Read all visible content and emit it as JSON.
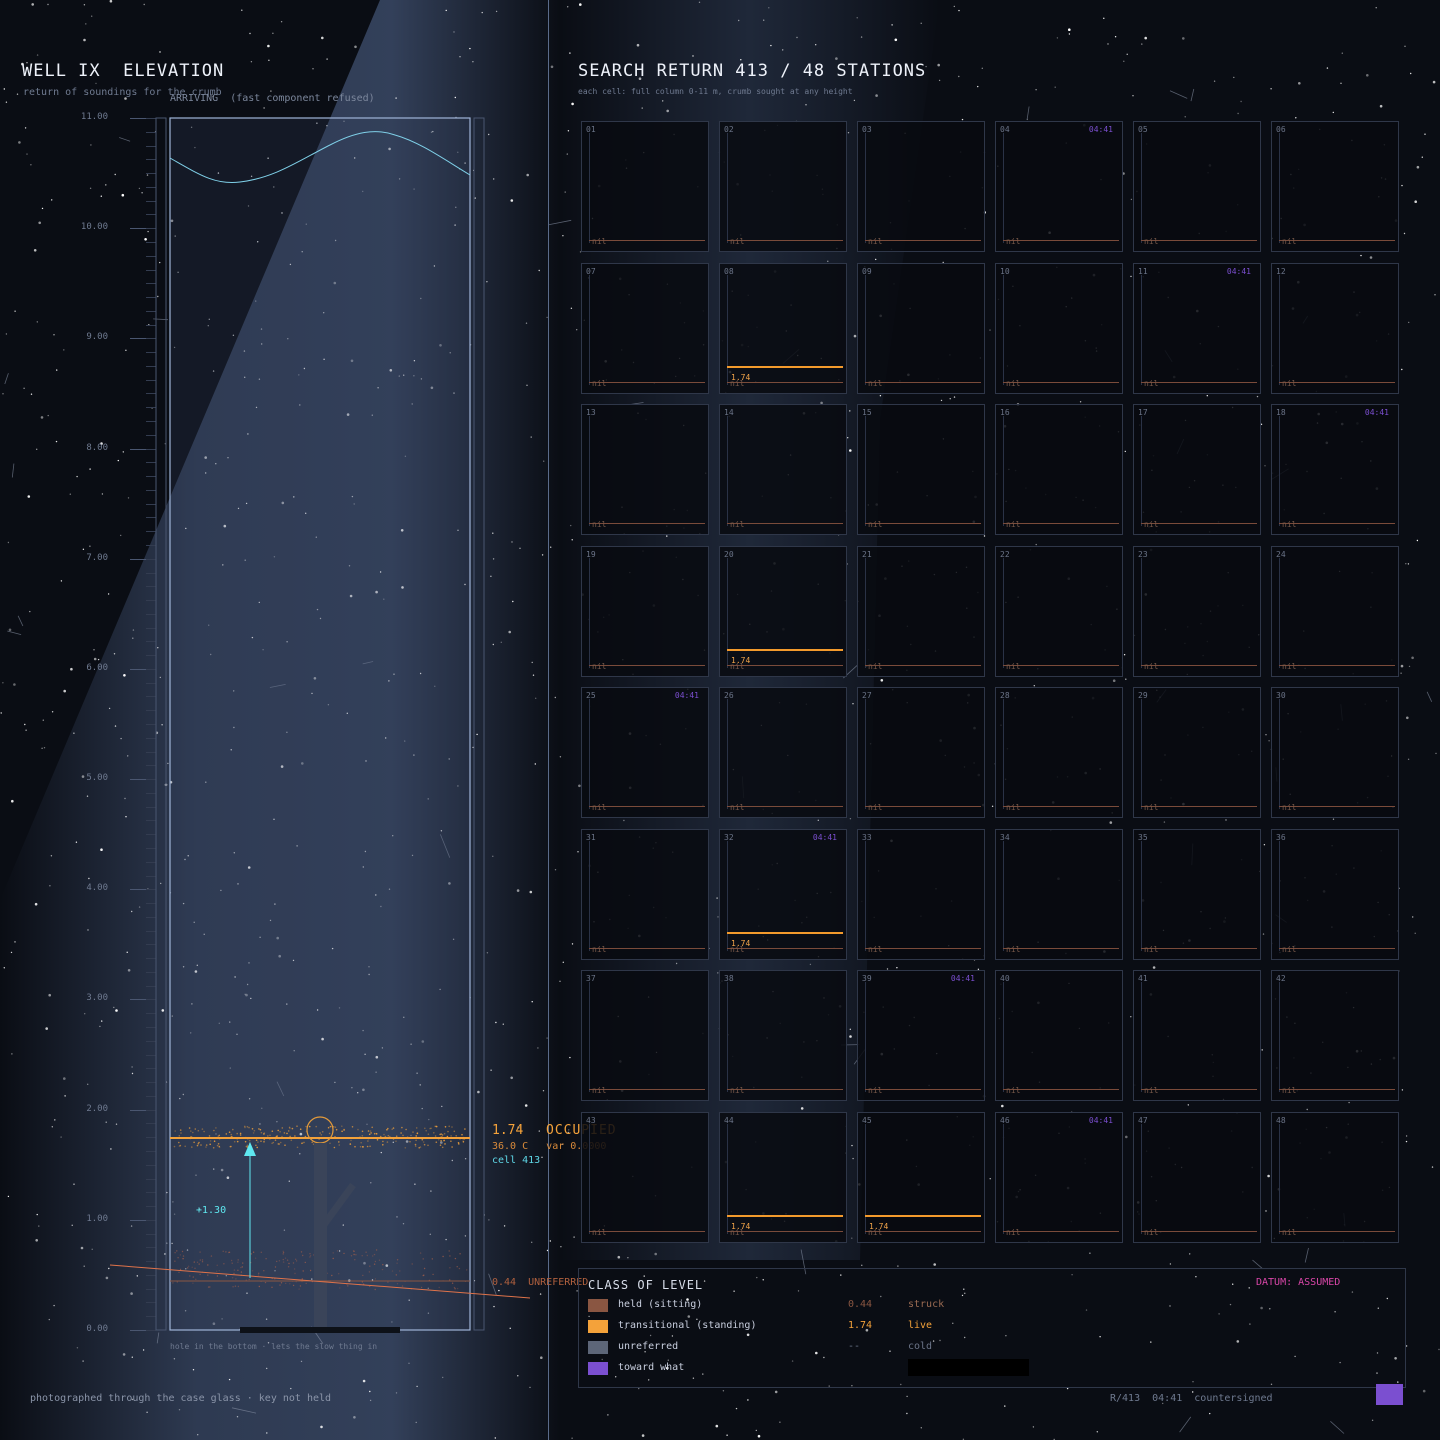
{
  "left": {
    "title": "WELL IX  ELEVATION",
    "subtitle": "return of soundings for the crumb",
    "arriving": "ARRIVING  (fast component refused)",
    "ticks": [
      "11.00",
      "10.00",
      "9.00",
      "8.00",
      "7.00",
      "6.00",
      "5.00",
      "4.00",
      "3.00",
      "2.00",
      "1.00",
      "0.00"
    ],
    "occupied_value": "1.74",
    "occupied_label": "OCCUPIED",
    "temp_var": "36.0 C   var 0.0000",
    "cell_ref": "cell 413",
    "delta": "+1.30",
    "unreferred": "0.44  UNREFERRED",
    "bottom_note": "hole in the bottom · lets the slow thing in",
    "footer": "photographed through the case glass · key not held"
  },
  "right": {
    "title": "SEARCH RETURN 413 / 48 STATIONS",
    "subtitle": "each cell: full column 0-11 m, crumb sought at any height",
    "cells": [
      {
        "n": "01",
        "time": "",
        "level": ""
      },
      {
        "n": "02",
        "time": "",
        "level": ""
      },
      {
        "n": "03",
        "time": "",
        "level": ""
      },
      {
        "n": "04",
        "time": "04:41",
        "level": ""
      },
      {
        "n": "05",
        "time": "",
        "level": ""
      },
      {
        "n": "06",
        "time": "",
        "level": ""
      },
      {
        "n": "07",
        "time": "",
        "level": ""
      },
      {
        "n": "08",
        "time": "",
        "level": "1.74"
      },
      {
        "n": "09",
        "time": "",
        "level": ""
      },
      {
        "n": "10",
        "time": "",
        "level": ""
      },
      {
        "n": "11",
        "time": "04:41",
        "level": ""
      },
      {
        "n": "12",
        "time": "",
        "level": ""
      },
      {
        "n": "13",
        "time": "",
        "level": ""
      },
      {
        "n": "14",
        "time": "",
        "level": ""
      },
      {
        "n": "15",
        "time": "",
        "level": ""
      },
      {
        "n": "16",
        "time": "",
        "level": ""
      },
      {
        "n": "17",
        "time": "",
        "level": ""
      },
      {
        "n": "18",
        "time": "04:41",
        "level": ""
      },
      {
        "n": "19",
        "time": "",
        "level": ""
      },
      {
        "n": "20",
        "time": "",
        "level": "1.74"
      },
      {
        "n": "21",
        "time": "",
        "level": ""
      },
      {
        "n": "22",
        "time": "",
        "level": ""
      },
      {
        "n": "23",
        "time": "",
        "level": ""
      },
      {
        "n": "24",
        "time": "",
        "level": ""
      },
      {
        "n": "25",
        "time": "04:41",
        "level": ""
      },
      {
        "n": "26",
        "time": "",
        "level": ""
      },
      {
        "n": "27",
        "time": "",
        "level": ""
      },
      {
        "n": "28",
        "time": "",
        "level": ""
      },
      {
        "n": "29",
        "time": "",
        "level": ""
      },
      {
        "n": "30",
        "time": "",
        "level": ""
      },
      {
        "n": "31",
        "time": "",
        "level": ""
      },
      {
        "n": "32",
        "time": "04:41",
        "level": "1.74"
      },
      {
        "n": "33",
        "time": "",
        "level": ""
      },
      {
        "n": "34",
        "time": "",
        "level": ""
      },
      {
        "n": "35",
        "time": "",
        "level": ""
      },
      {
        "n": "36",
        "time": "",
        "level": ""
      },
      {
        "n": "37",
        "time": "",
        "level": ""
      },
      {
        "n": "38",
        "time": "",
        "level": ""
      },
      {
        "n": "39",
        "time": "04:41",
        "level": ""
      },
      {
        "n": "40",
        "time": "",
        "level": ""
      },
      {
        "n": "41",
        "time": "",
        "level": ""
      },
      {
        "n": "42",
        "time": "",
        "level": ""
      },
      {
        "n": "43",
        "time": "",
        "level": ""
      },
      {
        "n": "44",
        "time": "",
        "level": "1.74"
      },
      {
        "n": "45",
        "time": "",
        "level": "1.74"
      },
      {
        "n": "46",
        "time": "04:41",
        "level": ""
      },
      {
        "n": "47",
        "time": "",
        "level": ""
      },
      {
        "n": "48",
        "time": "",
        "level": ""
      }
    ],
    "nil_label": "nil"
  },
  "legend": {
    "title": "CLASS OF LEVEL",
    "datum": "DATUM: ASSUMED",
    "rows": [
      {
        "color": "#8a5642",
        "label": "held (sitting)",
        "value": "0.44",
        "state": "struck",
        "state_color": "#9a6a52"
      },
      {
        "color": "#f4a23a",
        "label": "transitional (standing)",
        "value": "1.74",
        "state": "live",
        "state_color": "#f4a23a"
      },
      {
        "color": "#5d6678",
        "label": "unreferred",
        "value": "--",
        "state": "cold",
        "state_color": "#6b7488"
      },
      {
        "color": "#7b4fd0",
        "label": "toward what",
        "value": "",
        "state": "",
        "state_color": "#7b4fd0"
      }
    ]
  },
  "footer_right": "R/413  04:41  countersigned",
  "colors": {
    "accent_orange": "#f4a23a",
    "accent_cyan": "#5fe8f0",
    "accent_violet": "#7b4fd0",
    "accent_pink": "#d946a8"
  }
}
